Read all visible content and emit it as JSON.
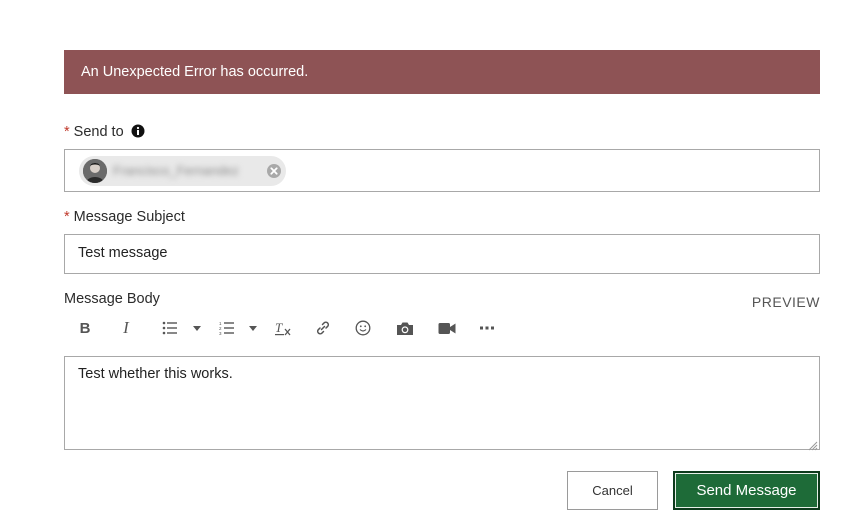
{
  "error": {
    "message": "An Unexpected Error has occurred."
  },
  "send_to": {
    "label": "Send to",
    "required_mark": "*",
    "recipient": "Francisco_Fernandez"
  },
  "subject": {
    "label": "Message Subject",
    "required_mark": "*",
    "value": "Test message"
  },
  "body": {
    "label": "Message Body",
    "preview_label": "PREVIEW",
    "value": "Test whether this works.",
    "toolbar": {
      "bold": "B",
      "italic": "I",
      "icons": [
        "bold-icon",
        "italic-icon",
        "bulleted-list-icon",
        "numbered-list-icon",
        "clear-formatting-icon",
        "link-icon",
        "emoji-icon",
        "camera-icon",
        "video-icon",
        "more-icon"
      ]
    }
  },
  "actions": {
    "cancel": "Cancel",
    "send": "Send Message"
  },
  "colors": {
    "error_bg": "#8e5355",
    "primary": "#1e6b38",
    "required": "#c0392b"
  }
}
